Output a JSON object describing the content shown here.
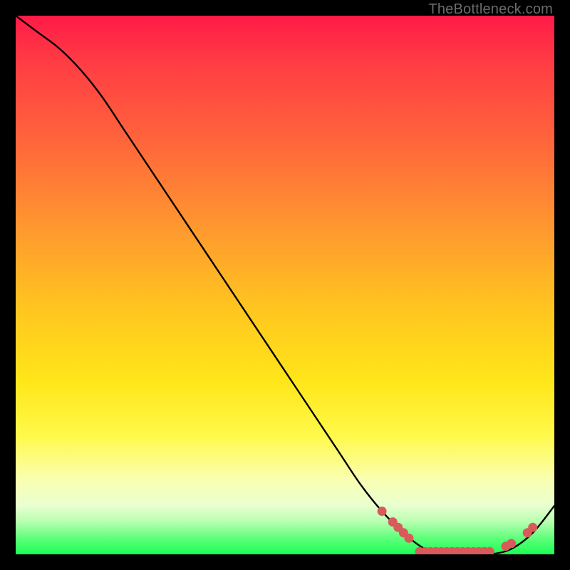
{
  "watermark": "TheBottleneck.com",
  "chart_data": {
    "type": "line",
    "title": "",
    "xlabel": "",
    "ylabel": "",
    "xlim": [
      0,
      100
    ],
    "ylim": [
      0,
      100
    ],
    "series": [
      {
        "name": "bottleneck-curve",
        "x": [
          0,
          4,
          8,
          12,
          16,
          20,
          24,
          28,
          32,
          36,
          40,
          44,
          48,
          52,
          56,
          60,
          64,
          68,
          72,
          76,
          80,
          84,
          88,
          92,
          96,
          100
        ],
        "y": [
          100,
          97,
          94,
          90,
          85,
          79,
          73,
          67,
          61,
          55,
          49,
          43,
          37,
          31,
          25,
          19,
          13,
          8,
          4,
          1,
          0,
          0,
          0,
          1,
          4,
          9
        ]
      }
    ],
    "markers": {
      "name": "highlight-points",
      "color": "#d85a5a",
      "points": [
        {
          "x": 68,
          "y": 8
        },
        {
          "x": 70,
          "y": 6
        },
        {
          "x": 71,
          "y": 5
        },
        {
          "x": 72,
          "y": 4
        },
        {
          "x": 73,
          "y": 3
        },
        {
          "x": 75,
          "y": 0.5
        },
        {
          "x": 76,
          "y": 0.5
        },
        {
          "x": 77,
          "y": 0.5
        },
        {
          "x": 78,
          "y": 0.5
        },
        {
          "x": 79,
          "y": 0.5
        },
        {
          "x": 80,
          "y": 0.5
        },
        {
          "x": 81,
          "y": 0.5
        },
        {
          "x": 82,
          "y": 0.5
        },
        {
          "x": 83,
          "y": 0.5
        },
        {
          "x": 84,
          "y": 0.5
        },
        {
          "x": 85,
          "y": 0.5
        },
        {
          "x": 86,
          "y": 0.5
        },
        {
          "x": 87,
          "y": 0.5
        },
        {
          "x": 88,
          "y": 0.5
        },
        {
          "x": 91,
          "y": 1.5
        },
        {
          "x": 92,
          "y": 2
        },
        {
          "x": 95,
          "y": 4
        },
        {
          "x": 96,
          "y": 5
        }
      ]
    },
    "gradient_stops": [
      {
        "pos": 0,
        "color": "#ff1a47"
      },
      {
        "pos": 25,
        "color": "#ff6a3a"
      },
      {
        "pos": 55,
        "color": "#ffc71f"
      },
      {
        "pos": 78,
        "color": "#fff94a"
      },
      {
        "pos": 100,
        "color": "#1aff55"
      }
    ]
  }
}
